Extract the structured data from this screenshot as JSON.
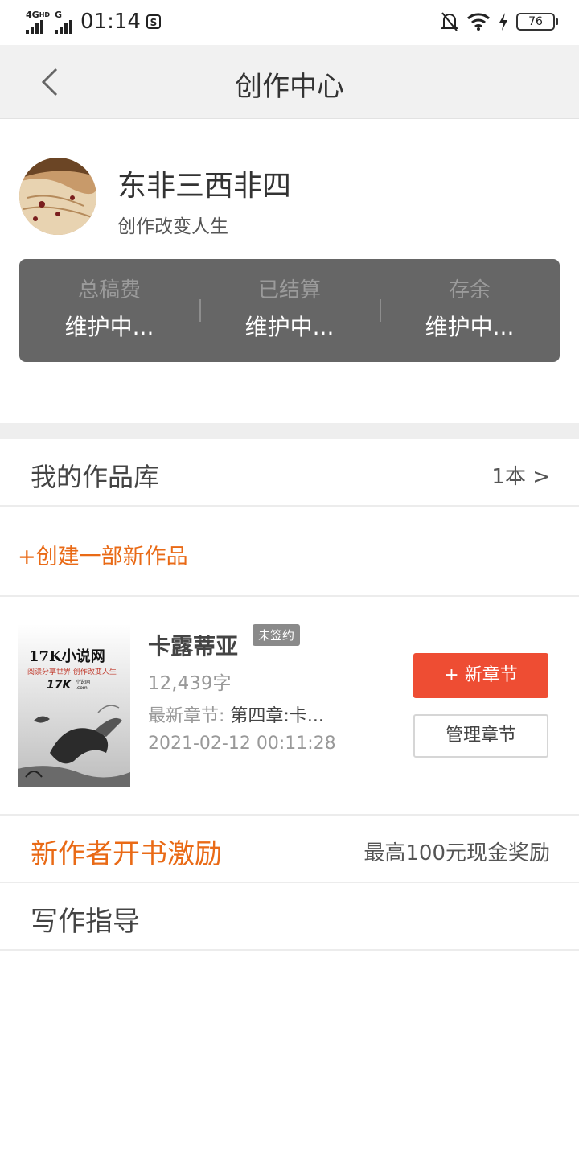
{
  "status_bar": {
    "network": "4G",
    "network_sub": "HD",
    "network2": "G",
    "time": "01:14",
    "battery": "76"
  },
  "header": {
    "title": "创作中心"
  },
  "profile": {
    "name": "东非三西非四",
    "motto": "创作改变人生",
    "stats": [
      {
        "label": "总稿费",
        "value": "维护中..."
      },
      {
        "label": "已结算",
        "value": "维护中..."
      },
      {
        "label": "存余",
        "value": "维护中..."
      }
    ]
  },
  "library": {
    "title": "我的作品库",
    "count": "1本 >"
  },
  "create": {
    "label": "+创建一部新作品"
  },
  "book": {
    "title": "卡露蒂亚",
    "tag": "未签约",
    "words": "12,439字",
    "latest_label": "最新章节:",
    "latest_value": "第四章:卡...",
    "date": "2021-02-12 00:11:28",
    "new_chapter": "+ 新章节",
    "manage_chapter": "管理章节",
    "cover": {
      "brand": "17K小说网",
      "slogan": "阅读分享世界 创作改变人生",
      "logo": "17K",
      "logo_sub": "小说网",
      "logo_dot": ".com"
    }
  },
  "promo": {
    "title": "新作者开书激励",
    "reward": "最高100元现金奖励"
  },
  "guide": {
    "title": "写作指导"
  }
}
